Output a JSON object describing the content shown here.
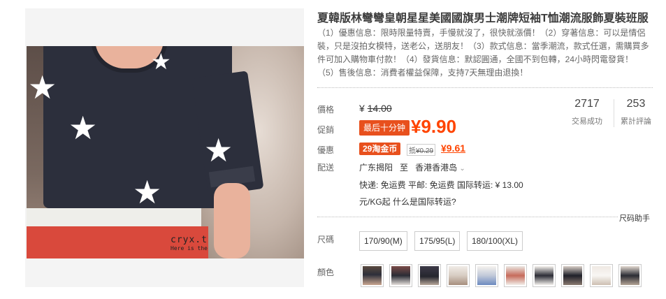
{
  "product": {
    "title": "夏韓版林彎彎皇朝星星美國國旗男士潮牌短袖T恤潮流服飾夏裝班服",
    "promo_lines": [
      "（1）優惠信息：限時限量特賣，手慢就沒了，很快就漲價！（2）穿著信息：可以是情侶",
      "裝，只是沒拍女模特，送老公，送朋友！（3）款式信息：當季潮流，款式任選，需購買多",
      "件可加入購物車付款！（4）發貨信息：默認圓通，全國不到包轉，24小時閃電發貨！",
      "（5）售後信息：消費者權益保障，支持7天無理由退換！"
    ],
    "watermark_1": "cryx.t",
    "watermark_2": "Here is the"
  },
  "labels": {
    "price": "價格",
    "promo": "促銷",
    "discount": "優惠",
    "delivery": "配送",
    "size": "尺碼",
    "color": "顏色"
  },
  "pricing": {
    "currency": "¥",
    "original": "14.00",
    "countdown_tag": "最后十分钟",
    "current": "¥9.90",
    "coin_tag": "29淘金币",
    "coin_prefix": "抵",
    "coin_deduct": "¥0.29",
    "coin_price": "¥9.61"
  },
  "stats": {
    "sold_count": "2717",
    "sold_label": "交易成功",
    "reviews_count": "253",
    "reviews_label": "累計評論"
  },
  "shipping": {
    "from": "广东揭阳",
    "to_word": "至",
    "destination": "香港香港岛",
    "rates": "快递: 免运费   平邮: 免运费   国际转运: ¥ 13.00",
    "intl_note": "元/KG起 什么是国际转运?",
    "size_helper": "尺码助手"
  },
  "sizes": [
    "170/90(M)",
    "175/95(L)",
    "180/100(XL)"
  ],
  "colors": {
    "accent": "#ff4400",
    "tag": "#e8501d"
  }
}
